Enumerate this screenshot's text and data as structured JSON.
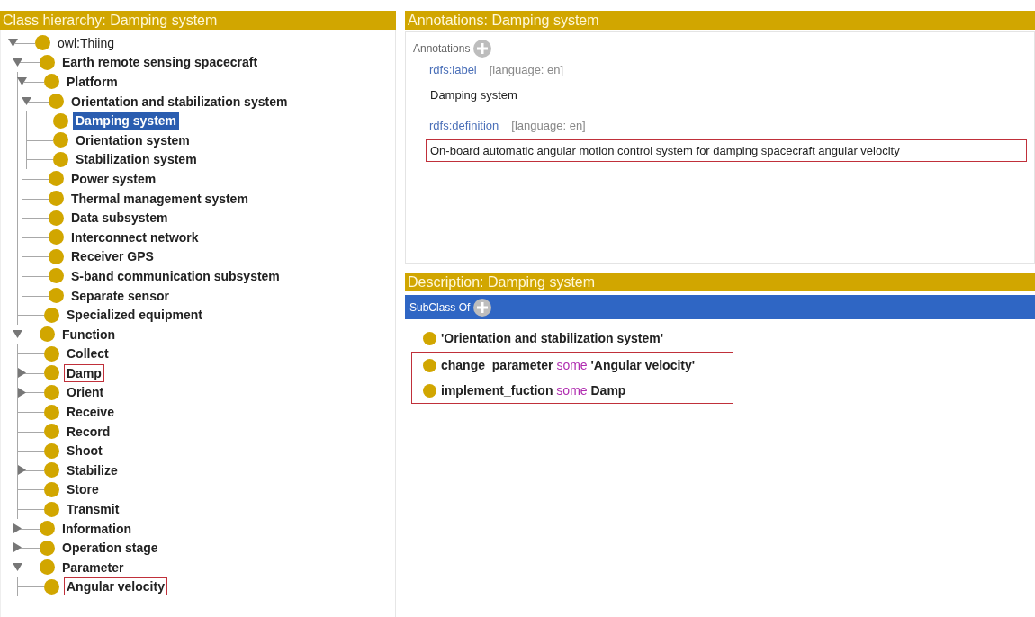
{
  "class_hierarchy": {
    "title": "Class hierarchy: Damping system",
    "tree": [
      {
        "label": "owl:Thiing",
        "expanded": true,
        "selected": false,
        "highlighted": false,
        "children": [
          {
            "label": "Earth remote sensing spacecraft",
            "expanded": true,
            "selected": false,
            "highlighted": false,
            "children": [
              {
                "label": "Platform",
                "expanded": true,
                "selected": false,
                "highlighted": false,
                "children": [
                  {
                    "label": "Orientation and stabilization system",
                    "expanded": true,
                    "selected": false,
                    "highlighted": false,
                    "children": [
                      {
                        "label": "Damping system",
                        "selected": true,
                        "highlighted": false
                      },
                      {
                        "label": "Orientation system",
                        "selected": false,
                        "highlighted": false
                      },
                      {
                        "label": "Stabilization system",
                        "selected": false,
                        "highlighted": false
                      }
                    ]
                  },
                  {
                    "label": "Power system",
                    "selected": false,
                    "highlighted": false
                  },
                  {
                    "label": "Thermal management system",
                    "selected": false,
                    "highlighted": false
                  },
                  {
                    "label": "Data subsystem",
                    "selected": false,
                    "highlighted": false
                  },
                  {
                    "label": "Interconnect network",
                    "selected": false,
                    "highlighted": false
                  },
                  {
                    "label": "Receiver GPS",
                    "selected": false,
                    "highlighted": false
                  },
                  {
                    "label": "S-band communication subsystem",
                    "selected": false,
                    "highlighted": false
                  },
                  {
                    "label": "Separate sensor",
                    "selected": false,
                    "highlighted": false
                  }
                ]
              },
              {
                "label": "Specialized equipment",
                "selected": false,
                "highlighted": false
              }
            ]
          },
          {
            "label": "Function",
            "expanded": true,
            "selected": false,
            "highlighted": false,
            "children": [
              {
                "label": "Collect",
                "selected": false,
                "highlighted": false
              },
              {
                "label": "Damp",
                "expanded": false,
                "selected": false,
                "highlighted": true
              },
              {
                "label": "Orient",
                "expanded": false,
                "selected": false,
                "highlighted": false
              },
              {
                "label": "Receive",
                "selected": false,
                "highlighted": false
              },
              {
                "label": "Record",
                "selected": false,
                "highlighted": false
              },
              {
                "label": "Shoot",
                "selected": false,
                "highlighted": false
              },
              {
                "label": "Stabilize",
                "expanded": false,
                "selected": false,
                "highlighted": false
              },
              {
                "label": "Store",
                "selected": false,
                "highlighted": false
              },
              {
                "label": "Transmit",
                "selected": false,
                "highlighted": false
              }
            ]
          },
          {
            "label": "Information",
            "expanded": false,
            "selected": false,
            "highlighted": false
          },
          {
            "label": "Operation stage",
            "expanded": false,
            "selected": false,
            "highlighted": false
          },
          {
            "label": "Parameter",
            "expanded": true,
            "selected": false,
            "highlighted": false,
            "children": [
              {
                "label": "Angular velocity",
                "selected": false,
                "highlighted": true
              }
            ]
          }
        ]
      }
    ]
  },
  "annotations": {
    "title": "Annotations: Damping system",
    "section_label": "Annotations",
    "items": [
      {
        "property": "rdfs:label",
        "language": "[language: en]",
        "value": "Damping system",
        "highlighted": false
      },
      {
        "property": "rdfs:definition",
        "language": "[language: en]",
        "value": "On-board automatic angular motion control system for damping spacecraft angular velocity",
        "highlighted": true
      }
    ]
  },
  "description": {
    "title": "Description: Damping system",
    "section_label": "SubClass Of",
    "items": [
      {
        "text": "'Orientation and stabilization system'",
        "highlighted": false
      },
      {
        "text": "change_parameter *some* 'Angular velocity'",
        "highlighted": true
      },
      {
        "text": "implement_fuction *some* Damp",
        "highlighted": true
      }
    ]
  }
}
